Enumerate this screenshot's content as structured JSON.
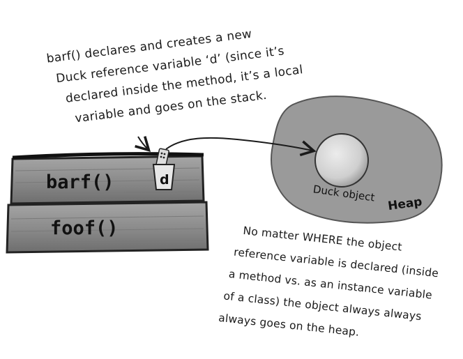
{
  "annotation_top": {
    "lines": [
      "barf() declares and creates a new",
      "Duck reference variable ‘d’ (since it’s",
      "declared inside the method, it’s a local",
      "variable and goes on the stack."
    ]
  },
  "stack": {
    "frames": [
      {
        "label": "barf()"
      },
      {
        "label": "foof()"
      }
    ],
    "variable": {
      "label": "d"
    }
  },
  "heap": {
    "label": "Heap",
    "object": {
      "label": "Duck object"
    }
  },
  "annotation_bottom": {
    "lines": [
      "No matter WHERE the object",
      "reference variable is declared (inside",
      "a method vs. as an instance variable",
      "of a class) the object always always",
      "always goes on the heap."
    ]
  },
  "colors": {
    "stack_frame": "#8a8a8a",
    "heap_blob": "#9a9a9a",
    "duck_object": "#d4d4d4",
    "ink": "#1a1a1a"
  }
}
